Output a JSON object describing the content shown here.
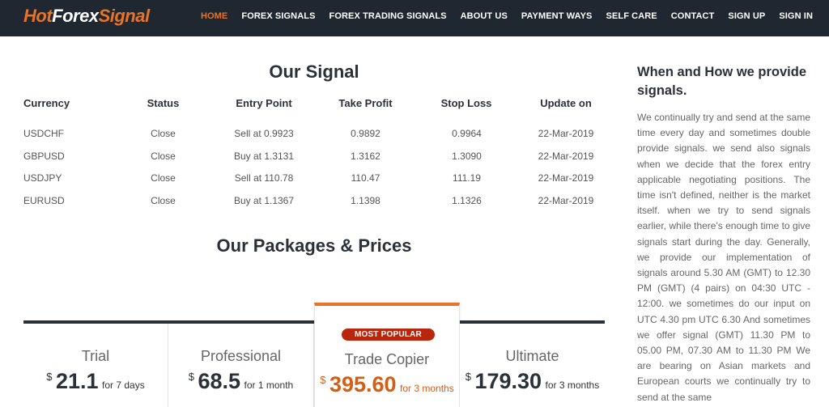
{
  "brand": {
    "part1": "Hot",
    "part2": "Forex",
    "part3": "Signal"
  },
  "nav": {
    "items": [
      {
        "label": "HOME",
        "active": true
      },
      {
        "label": "FOREX SIGNALS"
      },
      {
        "label": "FOREX TRADING SIGNALS"
      },
      {
        "label": "ABOUT US"
      },
      {
        "label": "PAYMENT WAYS"
      },
      {
        "label": "SELF CARE"
      },
      {
        "label": "CONTACT"
      },
      {
        "label": "SIGN UP"
      },
      {
        "label": "SIGN IN"
      }
    ]
  },
  "signal": {
    "title": "Our Signal",
    "columns": [
      "Currency",
      "Status",
      "Entry Point",
      "Take Profit",
      "Stop Loss",
      "Update on"
    ],
    "rows": [
      [
        "USDCHF",
        "Close",
        "Sell at 0.9923",
        "0.9892",
        "0.9964",
        "22-Mar-2019"
      ],
      [
        "GBPUSD",
        "Close",
        "Buy at 1.3131",
        "1.3162",
        "1.3090",
        "22-Mar-2019"
      ],
      [
        "USDJPY",
        "Close",
        "Sell at 110.78",
        "110.47",
        "111.19",
        "22-Mar-2019"
      ],
      [
        "EURUSD",
        "Close",
        "Buy at 1.1367",
        "1.1398",
        "1.1326",
        "22-Mar-2019"
      ]
    ]
  },
  "packages": {
    "title": "Our Packages & Prices",
    "badge": "MOST POPULAR",
    "items": [
      {
        "name": "Trial",
        "currency": "$",
        "amount": "21.1",
        "period": "for 7 days"
      },
      {
        "name": "Professional",
        "currency": "$",
        "amount": "68.5",
        "period": "for 1 month"
      },
      {
        "name": "Trade Copier",
        "currency": "$",
        "amount": "395.60",
        "period": "for 3 months"
      },
      {
        "name": "Ultimate",
        "currency": "$",
        "amount": "179.30",
        "period": "for 3 months"
      }
    ]
  },
  "sidebar": {
    "title": "When and How we provide signals.",
    "text": "We continually try and send at the same time every day and sometimes double provide signals. we send also signals when we decide that the forex entry applicable negotiating positions. The time isn't defined, neither is the market itself. when we try to send signals earlier, while there's enough time to give signals start during the day. Generally, we provide our implementation of signals around 5.30 AM (GMT) to 12.30 PM (GMT) (4 pairs) on 04:30 UTC - 12:00. we sometimes do our input on UTC 4.30 pm UTC 6.30 And sometimes we offer signal (GMT) 11.30 PM to 05.00 PM, 07.30 AM to 11.30 PM We are bearing on Asian markets and European courts we continually try to send at the same"
  },
  "colors": {
    "accent": "#e8732a",
    "nav_bg": "#1f2730",
    "badge": "#b8260d",
    "heading": "#2a3139"
  }
}
